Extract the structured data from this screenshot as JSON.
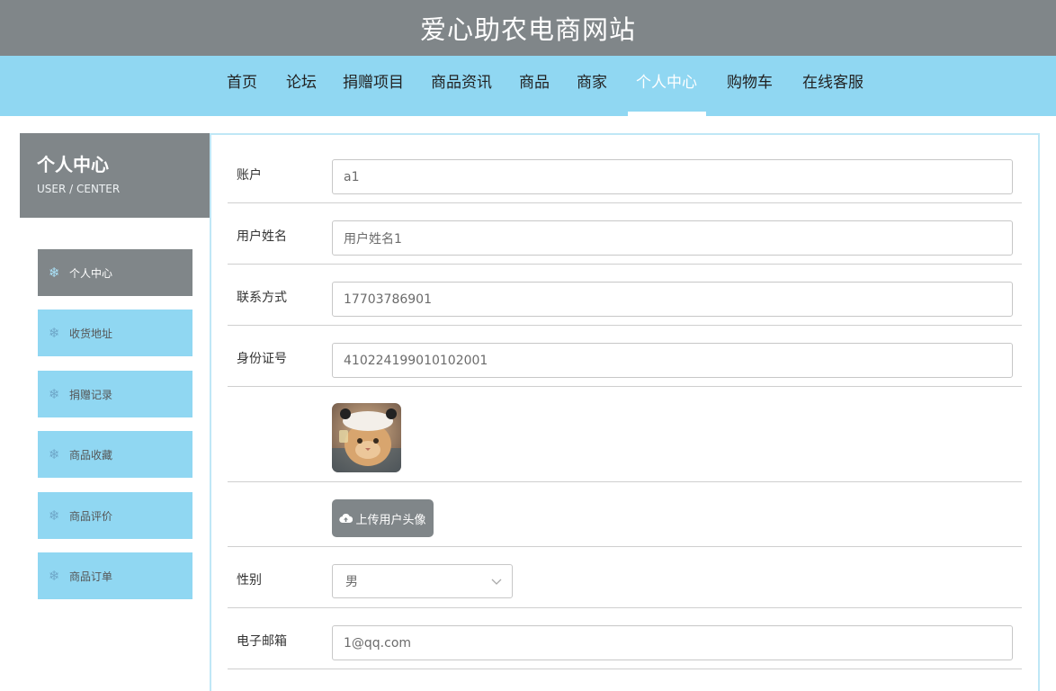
{
  "site": {
    "title": "爱心助农电商网站"
  },
  "nav": {
    "items": [
      {
        "label": "首页"
      },
      {
        "label": "论坛"
      },
      {
        "label": "捐赠项目"
      },
      {
        "label": "商品资讯"
      },
      {
        "label": "商品"
      },
      {
        "label": "商家"
      },
      {
        "label": "个人中心",
        "active": true
      },
      {
        "label": "购物车"
      },
      {
        "label": "在线客服"
      }
    ]
  },
  "sidebar": {
    "title": "个人中心",
    "subtitle": "USER / CENTER",
    "icon": "snowflake-icon",
    "items": [
      {
        "label": "个人中心",
        "active": true
      },
      {
        "label": "收货地址"
      },
      {
        "label": "捐赠记录"
      },
      {
        "label": "商品收藏"
      },
      {
        "label": "商品评价"
      },
      {
        "label": "商品订单"
      }
    ]
  },
  "form": {
    "account": {
      "label": "账户",
      "value": "a1"
    },
    "username": {
      "label": "用户姓名",
      "value": "用户姓名1"
    },
    "phone": {
      "label": "联系方式",
      "value": "17703786901"
    },
    "id_card": {
      "label": "身份证号",
      "value": "410224199010102001"
    },
    "avatar": {
      "icon": "avatar-cat-photo"
    },
    "upload": {
      "label": "上传用户头像",
      "icon": "cloud-upload-icon"
    },
    "gender": {
      "label": "性别",
      "value": "男"
    },
    "email": {
      "label": "电子邮箱",
      "value": "1@qq.com"
    }
  },
  "colors": {
    "header_bg": "#808689",
    "nav_bg": "#90d7f2",
    "active_text": "#ffffff",
    "panel_border": "#bfe7f6"
  }
}
